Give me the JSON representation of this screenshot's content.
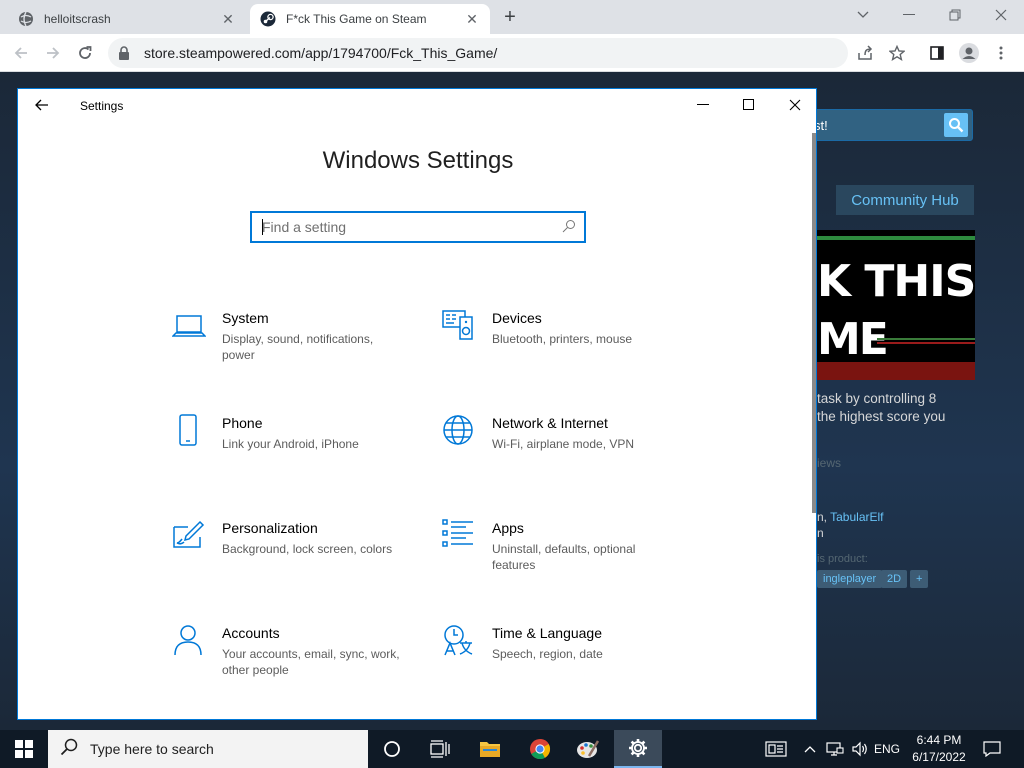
{
  "browser": {
    "tabs": [
      {
        "title": "helloitscrash",
        "close": "✕"
      },
      {
        "title": "F*ck This Game on Steam",
        "close": "✕"
      }
    ],
    "new_tab": "+",
    "url": "store.steampowered.com/app/1794700/Fck_This_Game/"
  },
  "steam": {
    "search_text": "st!",
    "community_hub": "Community Hub",
    "banner_line1": "K THIS",
    "banner_line2": "ME",
    "desc_line1": "task by controlling 8",
    "desc_line2": "the highest score you",
    "reviews": "iews",
    "dev_prefix": "n, ",
    "dev_link": "TabularElf",
    "dev_line2": "n",
    "tags_label": "is product:",
    "tags": [
      "ingleplayer",
      "2D",
      "+"
    ]
  },
  "settings": {
    "window_title": "Settings",
    "heading": "Windows Settings",
    "search_placeholder": "Find a setting",
    "categories": [
      {
        "name": "System",
        "desc": "Display, sound, notifications, power",
        "icon": "laptop-icon"
      },
      {
        "name": "Devices",
        "desc": "Bluetooth, printers, mouse",
        "icon": "devices-icon"
      },
      {
        "name": "Phone",
        "desc": "Link your Android, iPhone",
        "icon": "phone-icon"
      },
      {
        "name": "Network & Internet",
        "desc": "Wi-Fi, airplane mode, VPN",
        "icon": "globe-icon"
      },
      {
        "name": "Personalization",
        "desc": "Background, lock screen, colors",
        "icon": "paint-icon"
      },
      {
        "name": "Apps",
        "desc": "Uninstall, defaults, optional features",
        "icon": "apps-list-icon"
      },
      {
        "name": "Accounts",
        "desc": "Your accounts, email, sync, work, other people",
        "icon": "person-icon"
      },
      {
        "name": "Time & Language",
        "desc": "Speech, region, date",
        "icon": "time-language-icon"
      }
    ]
  },
  "taskbar": {
    "search_placeholder": "Type here to search",
    "language": "ENG",
    "time": "6:44 PM",
    "date": "6/17/2022"
  },
  "colors": {
    "accent": "#0078d7",
    "steam_link": "#67c1f5",
    "taskbar": "#0f1a26"
  }
}
